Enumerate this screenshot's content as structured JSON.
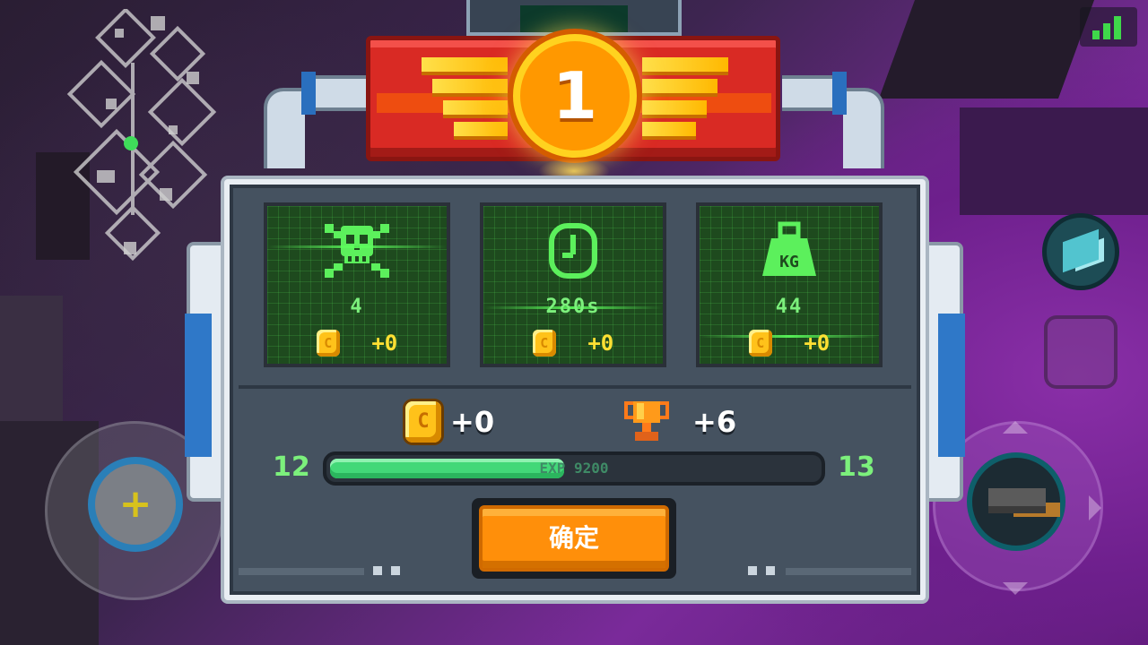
{
  "rank": {
    "number": "1"
  },
  "stats": [
    {
      "id": "kills",
      "icon": "skull-crossbones-icon",
      "value": "4",
      "coin_bonus": "+0"
    },
    {
      "id": "time",
      "icon": "clock-icon",
      "value": "280s",
      "coin_bonus": "+0"
    },
    {
      "id": "weight",
      "icon": "weight-kg-icon",
      "icon_text": "KG",
      "value": "44",
      "coin_bonus": "+0"
    }
  ],
  "rewards": {
    "coins": "+0",
    "trophies": "+6"
  },
  "experience": {
    "current_level": "12",
    "next_level": "13",
    "label": "EXP 9200",
    "progress": 0.48
  },
  "confirm_button": {
    "label": "确定"
  },
  "colors": {
    "screen_green": "#1e4a1e",
    "stat_text": "#7cf07c",
    "coin": "#ffc21a",
    "banner_red": "#d92a24",
    "confirm_orange": "#ff8f0a"
  }
}
